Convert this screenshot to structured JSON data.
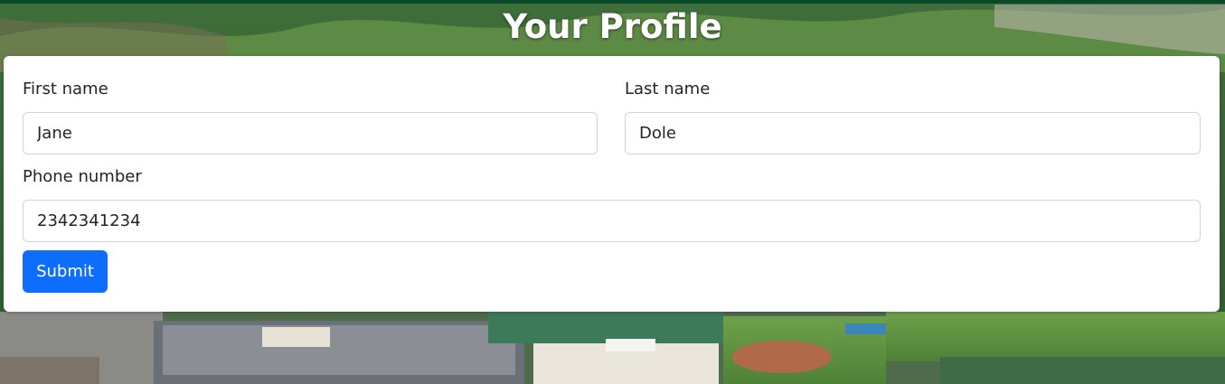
{
  "page": {
    "title": "Your Profile"
  },
  "form": {
    "first_name": {
      "label": "First name",
      "value": "Jane"
    },
    "last_name": {
      "label": "Last name",
      "value": "Dole"
    },
    "phone": {
      "label": "Phone number",
      "value": "2342341234"
    },
    "submit_label": "Submit"
  },
  "colors": {
    "accent": "#0d6efd",
    "header_stripe": "#0b4a28",
    "card_background": "#ffffff",
    "text": "#212529"
  }
}
